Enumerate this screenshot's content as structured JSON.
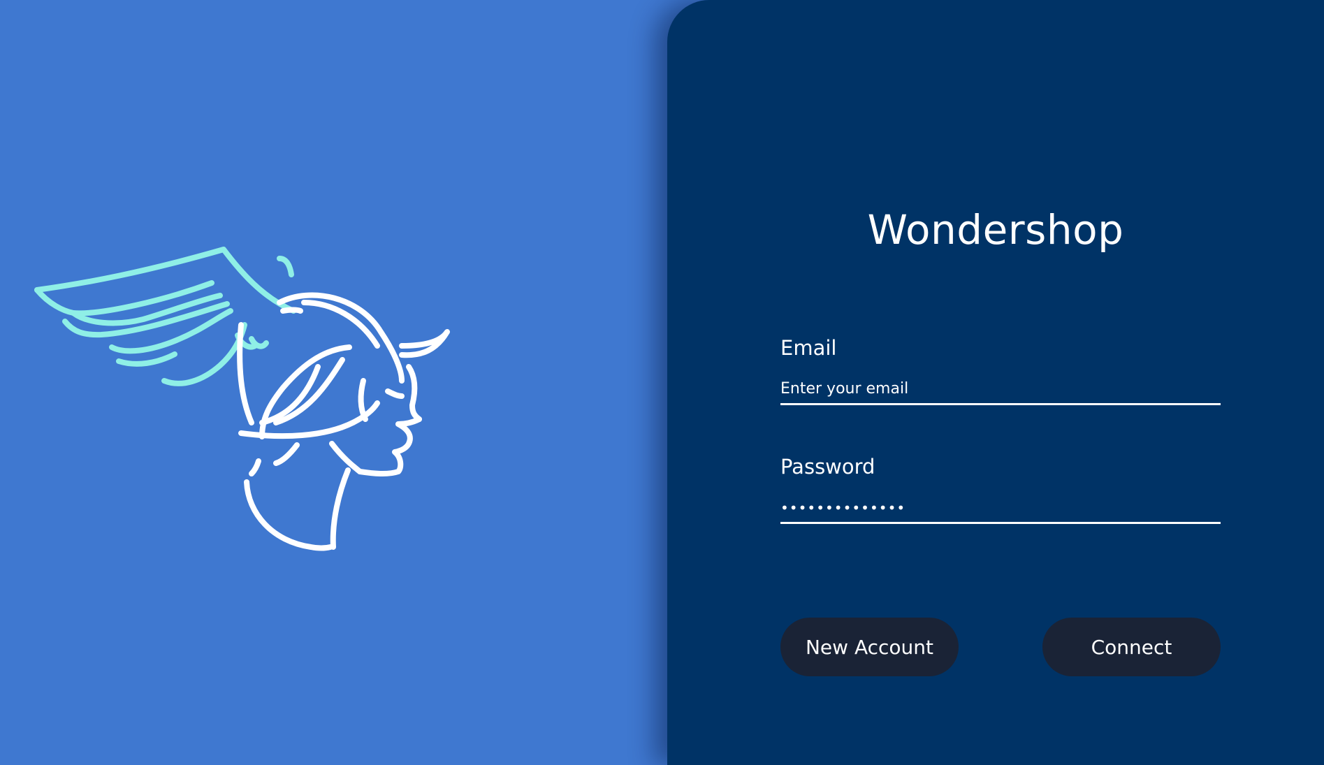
{
  "brand": {
    "title": "Wondershop",
    "logo_icon": "winged-helmet-head-icon"
  },
  "colors": {
    "background": "#3F78D0",
    "panel": "#003366",
    "button": "#1A2336",
    "logo_wing": "#8FEFE6",
    "logo_head": "#FFFFFF"
  },
  "form": {
    "email_label": "Email",
    "email_placeholder": "Enter your email",
    "email_value": "",
    "password_label": "Password",
    "password_value": "••••••••••••••"
  },
  "buttons": {
    "new_account": "New Account",
    "connect": "Connect"
  }
}
